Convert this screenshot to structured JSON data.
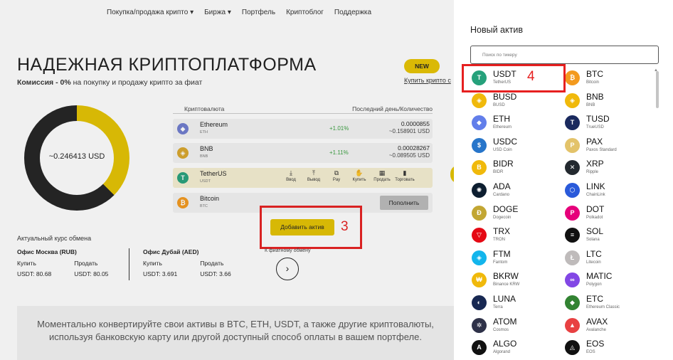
{
  "nav": [
    "Покупка/продажа крипто ▾",
    "Биржа ▾",
    "Портфель",
    "Криптоблог",
    "Поддержка"
  ],
  "hero": {
    "title": "НАДЕЖНАЯ КРИПТОПЛАТФОРМА",
    "sub_bold": "Комиссия - 0%",
    "sub_rest": " на покупку и продажу крипто за фиат",
    "new_badge": "NEW",
    "new_link": "Купить крипто с"
  },
  "donut": {
    "value": "~0.246413 USD",
    "gold_fraction": 0.375,
    "gold": "#e4c300",
    "dark": "#222222"
  },
  "table": {
    "col_left": "Криптовалюта",
    "col_right": "Последний день/Количество",
    "rows": [
      {
        "name": "Ethereum",
        "ticker": "ETH",
        "pct": "+1.01%",
        "qty": "0.0000855",
        "usd": "~0.158901 USD",
        "icon": "ethereum-icon",
        "color": "#6f7ccf",
        "glyph": "◆"
      },
      {
        "name": "BNB",
        "ticker": "BNB",
        "pct": "+1.11%",
        "qty": "0.00028267",
        "usd": "~0.089505 USD",
        "icon": "bnb-icon",
        "color": "#d9a62b",
        "glyph": "◈"
      },
      {
        "name": "TetherUS",
        "ticker": "USDT",
        "icon": "tether-icon",
        "color": "#26a17b",
        "glyph": "T"
      },
      {
        "name": "Bitcoin",
        "ticker": "BTC",
        "icon": "bitcoin-icon",
        "color": "#f39a1e",
        "glyph": "₿"
      }
    ],
    "actions": [
      {
        "label": "Ввод",
        "icon": "deposit-icon",
        "glyph": "⤓"
      },
      {
        "label": "Вывод",
        "icon": "withdraw-icon",
        "glyph": "⤒"
      },
      {
        "label": "Pay",
        "icon": "pay-icon",
        "glyph": "⧉"
      },
      {
        "label": "Купить",
        "icon": "buy-icon",
        "glyph": "✋"
      },
      {
        "label": "Продать",
        "icon": "sell-icon",
        "glyph": "▦"
      },
      {
        "label": "Торговать",
        "icon": "trade-icon",
        "glyph": "▮"
      }
    ],
    "replenish": "Пополнить"
  },
  "add_button": "Добавить актив",
  "annotation_3": "3",
  "annotation_4": "4",
  "rates": {
    "title": "Актуальный курс обмена",
    "offices": [
      {
        "name": "Офис Москва (RUB)",
        "buy_label": "Купить",
        "sell_label": "Продать",
        "buy": "USDT: 80.68",
        "sell": "USDT: 80.05"
      },
      {
        "name": "Офис Дубай (AED)",
        "buy_label": "Купить",
        "sell_label": "Продать",
        "buy": "USDT: 3.691",
        "sell": "USDT: 3.66"
      }
    ],
    "conv_link": "К фиатному обмену",
    "conv_glyph": "›"
  },
  "promo": "Моментально конвертируйте свои активы в BTC, ETH, USDT, а также другие криптовалюты, используя банковскую карту или другой доступный способ оплаты в вашем портфеле.",
  "panel": {
    "title": "Новый актив",
    "search_placeholder": "Поиск по тикеру",
    "assets": [
      {
        "t": "USDT",
        "n": "TetherUS",
        "c": "#26a17b",
        "g": "T",
        "icon": "tether-icon"
      },
      {
        "t": "BTC",
        "n": "Bitcoin",
        "c": "#f39a1e",
        "g": "₿",
        "icon": "bitcoin-icon"
      },
      {
        "t": "BUSD",
        "n": "BUSD",
        "c": "#f0b90b",
        "g": "◈",
        "icon": "busd-icon"
      },
      {
        "t": "BNB",
        "n": "BNB",
        "c": "#f0b90b",
        "g": "◈",
        "icon": "bnb-icon"
      },
      {
        "t": "ETH",
        "n": "Ethereum",
        "c": "#627eea",
        "g": "◆",
        "icon": "ethereum-icon"
      },
      {
        "t": "TUSD",
        "n": "TrueUSD",
        "c": "#1a2a5e",
        "g": "T",
        "icon": "trueusd-icon"
      },
      {
        "t": "USDC",
        "n": "USD Coin",
        "c": "#2775ca",
        "g": "$",
        "icon": "usdc-icon"
      },
      {
        "t": "PAX",
        "n": "Paxos Standard",
        "c": "#e3c36a",
        "g": "P",
        "icon": "pax-icon"
      },
      {
        "t": "BIDR",
        "n": "BIDR",
        "c": "#f0b90b",
        "g": "B",
        "icon": "bidr-icon"
      },
      {
        "t": "XRP",
        "n": "Ripple",
        "c": "#23292f",
        "g": "✕",
        "icon": "xrp-icon"
      },
      {
        "t": "ADA",
        "n": "Cardano",
        "c": "#0d1e30",
        "g": "✺",
        "icon": "cardano-icon"
      },
      {
        "t": "LINK",
        "n": "ChainLink",
        "c": "#2a5ada",
        "g": "⬡",
        "icon": "chainlink-icon"
      },
      {
        "t": "DOGE",
        "n": "Dogecoin",
        "c": "#c2a633",
        "g": "Ð",
        "icon": "dogecoin-icon"
      },
      {
        "t": "DOT",
        "n": "Polkadot",
        "c": "#e6007a",
        "g": "P",
        "icon": "polkadot-icon"
      },
      {
        "t": "TRX",
        "n": "TRON",
        "c": "#e50914",
        "g": "▽",
        "icon": "tron-icon"
      },
      {
        "t": "SOL",
        "n": "Solana",
        "c": "#111111",
        "g": "≡",
        "icon": "solana-icon"
      },
      {
        "t": "FTM",
        "n": "Fantom",
        "c": "#13b5ec",
        "g": "◈",
        "icon": "fantom-icon"
      },
      {
        "t": "LTC",
        "n": "Litecoin",
        "c": "#bfbbbb",
        "g": "Ł",
        "icon": "litecoin-icon"
      },
      {
        "t": "BKRW",
        "n": "Binance KRW",
        "c": "#f0b90b",
        "g": "₩",
        "icon": "bkrw-icon"
      },
      {
        "t": "MATIC",
        "n": "Polygon",
        "c": "#8247e5",
        "g": "∞",
        "icon": "polygon-icon"
      },
      {
        "t": "LUNA",
        "n": "Terra",
        "c": "#172852",
        "g": "◐",
        "icon": "terra-icon"
      },
      {
        "t": "ETC",
        "n": "Ethereum Classic",
        "c": "#328332",
        "g": "◆",
        "icon": "ethereum-classic-icon"
      },
      {
        "t": "ATOM",
        "n": "Cosmos",
        "c": "#2e3148",
        "g": "✲",
        "icon": "cosmos-icon"
      },
      {
        "t": "AVAX",
        "n": "Avalanche",
        "c": "#e84142",
        "g": "▲",
        "icon": "avalanche-icon"
      },
      {
        "t": "ALGO",
        "n": "Algorand",
        "c": "#111111",
        "g": "A",
        "icon": "algorand-icon"
      },
      {
        "t": "EOS",
        "n": "EOS",
        "c": "#111111",
        "g": "◬",
        "icon": "eos-icon"
      }
    ]
  }
}
